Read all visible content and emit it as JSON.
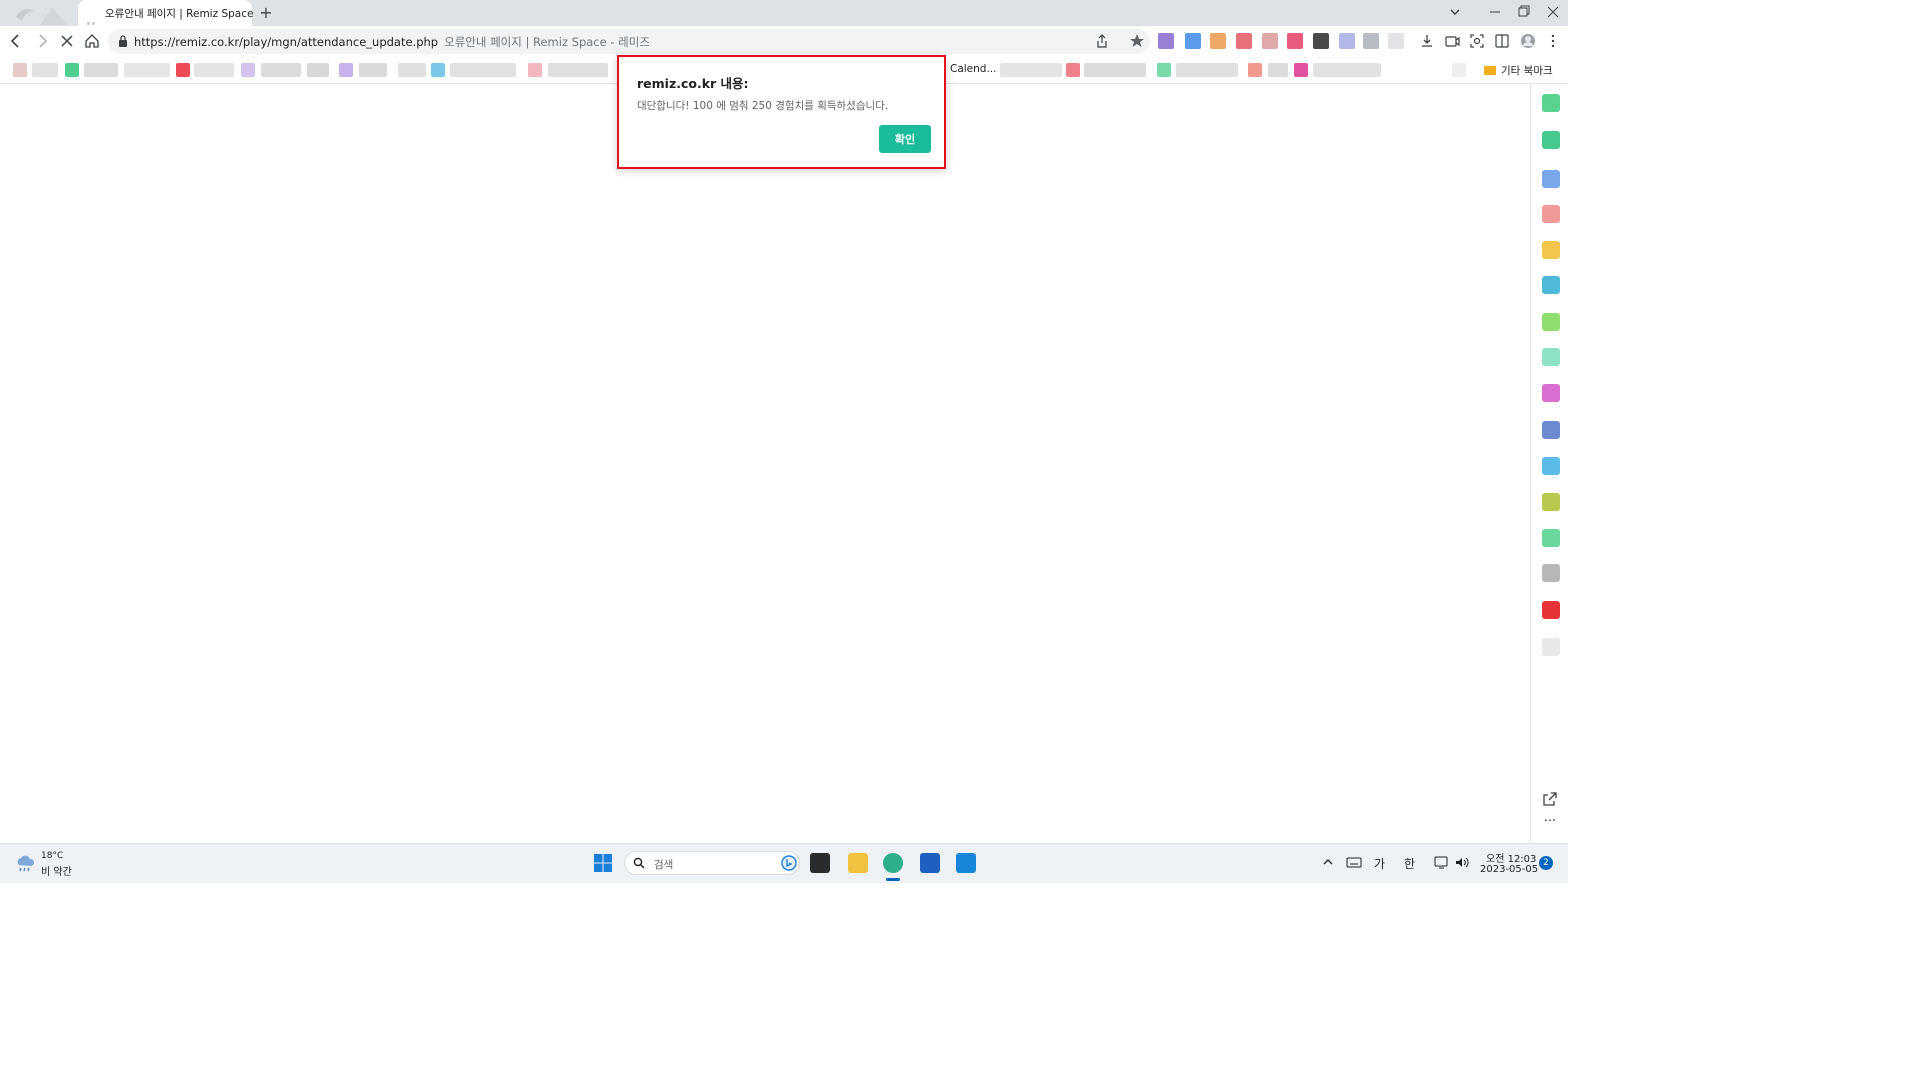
{
  "browser": {
    "tab": {
      "title": "오류안내 페이지 | Remiz Space"
    },
    "new_tab_label": "+",
    "url": "https://remiz.co.kr/play/mgn/attendance_update.php",
    "url_page_title": "오류안내 페이지 | Remiz Space - 레미즈",
    "bookmarks": {
      "visible_label": "Calend...",
      "other_bookmarks": "기타 북마크"
    }
  },
  "dialog": {
    "title": "remiz.co.kr 내용:",
    "message": "대단합니다! 100 에 멈춰 250 경험치를 획득하셨습니다.",
    "ok_button": "확인",
    "highlight_color": "#e0141b",
    "button_color": "#1abc9c"
  },
  "taskbar": {
    "weather": {
      "temp": "18°C",
      "desc": "비 약간"
    },
    "search_placeholder": "검색",
    "tray": {
      "ime_mode": "가",
      "ime_lang": "한"
    },
    "clock": {
      "time": "오전 12:03",
      "date": "2023-05-05"
    },
    "notification_count": "2"
  },
  "sidebar": {
    "more_label": "···"
  }
}
